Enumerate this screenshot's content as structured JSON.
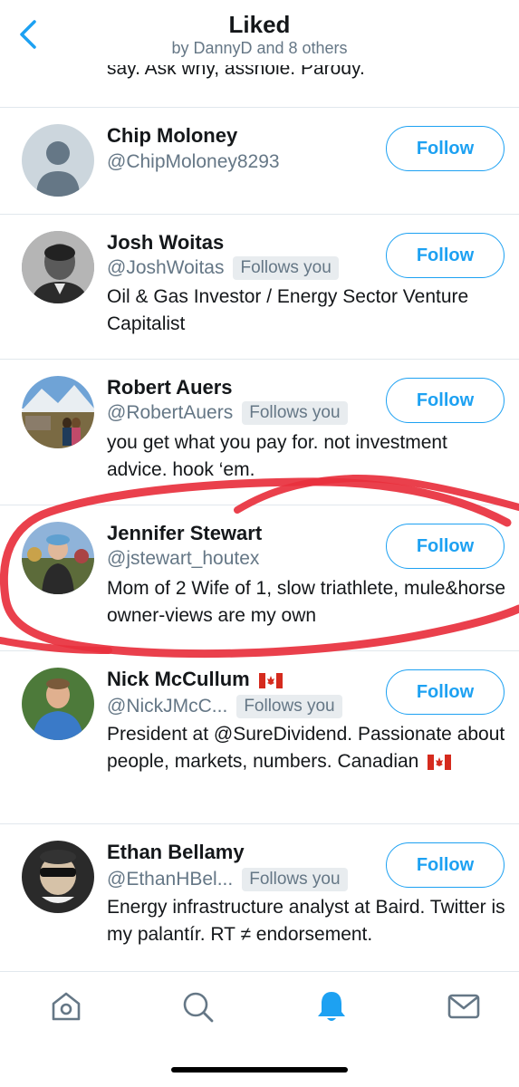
{
  "header": {
    "title": "Liked",
    "subtitle": "by DannyD and 8 others"
  },
  "partial_bio": "say. Ask why, asshole. Parody.",
  "follow_label": "Follow",
  "follows_you_label": "Follows you",
  "accent_color": "#1da1f2",
  "users": [
    {
      "name": "Chip Moloney",
      "handle": "@ChipMoloney8293",
      "follows_you": false,
      "bio": ""
    },
    {
      "name": "Josh Woitas",
      "handle": "@JoshWoitas",
      "follows_you": true,
      "bio": "Oil & Gas Investor / Energy Sector Venture Capitalist"
    },
    {
      "name": "Robert Auers",
      "handle": "@RobertAuers",
      "follows_you": true,
      "bio": "you get what you pay for. not investment advice. hook ‘em."
    },
    {
      "name": "Jennifer Stewart",
      "handle": "@jstewart_houtex",
      "follows_you": false,
      "bio": "Mom of 2 Wife of 1, slow triathlete, mule&horse owner-views are my own"
    },
    {
      "name": "Nick McCullum",
      "handle": "@NickJMcC...",
      "follows_you": true,
      "bio": "President at @SureDividend. Passionate about people, markets, numbers. Canadian"
    },
    {
      "name": "Ethan Bellamy",
      "handle": "@EthanHBel...",
      "follows_you": true,
      "bio": "Energy infrastructure analyst at Baird. Twitter is my palantír. RT ≠ endorsement."
    }
  ],
  "tabs": [
    {
      "name": "home-icon",
      "active": false
    },
    {
      "name": "search-icon",
      "active": false
    },
    {
      "name": "notifications-icon",
      "active": true
    },
    {
      "name": "messages-icon",
      "active": false
    }
  ]
}
